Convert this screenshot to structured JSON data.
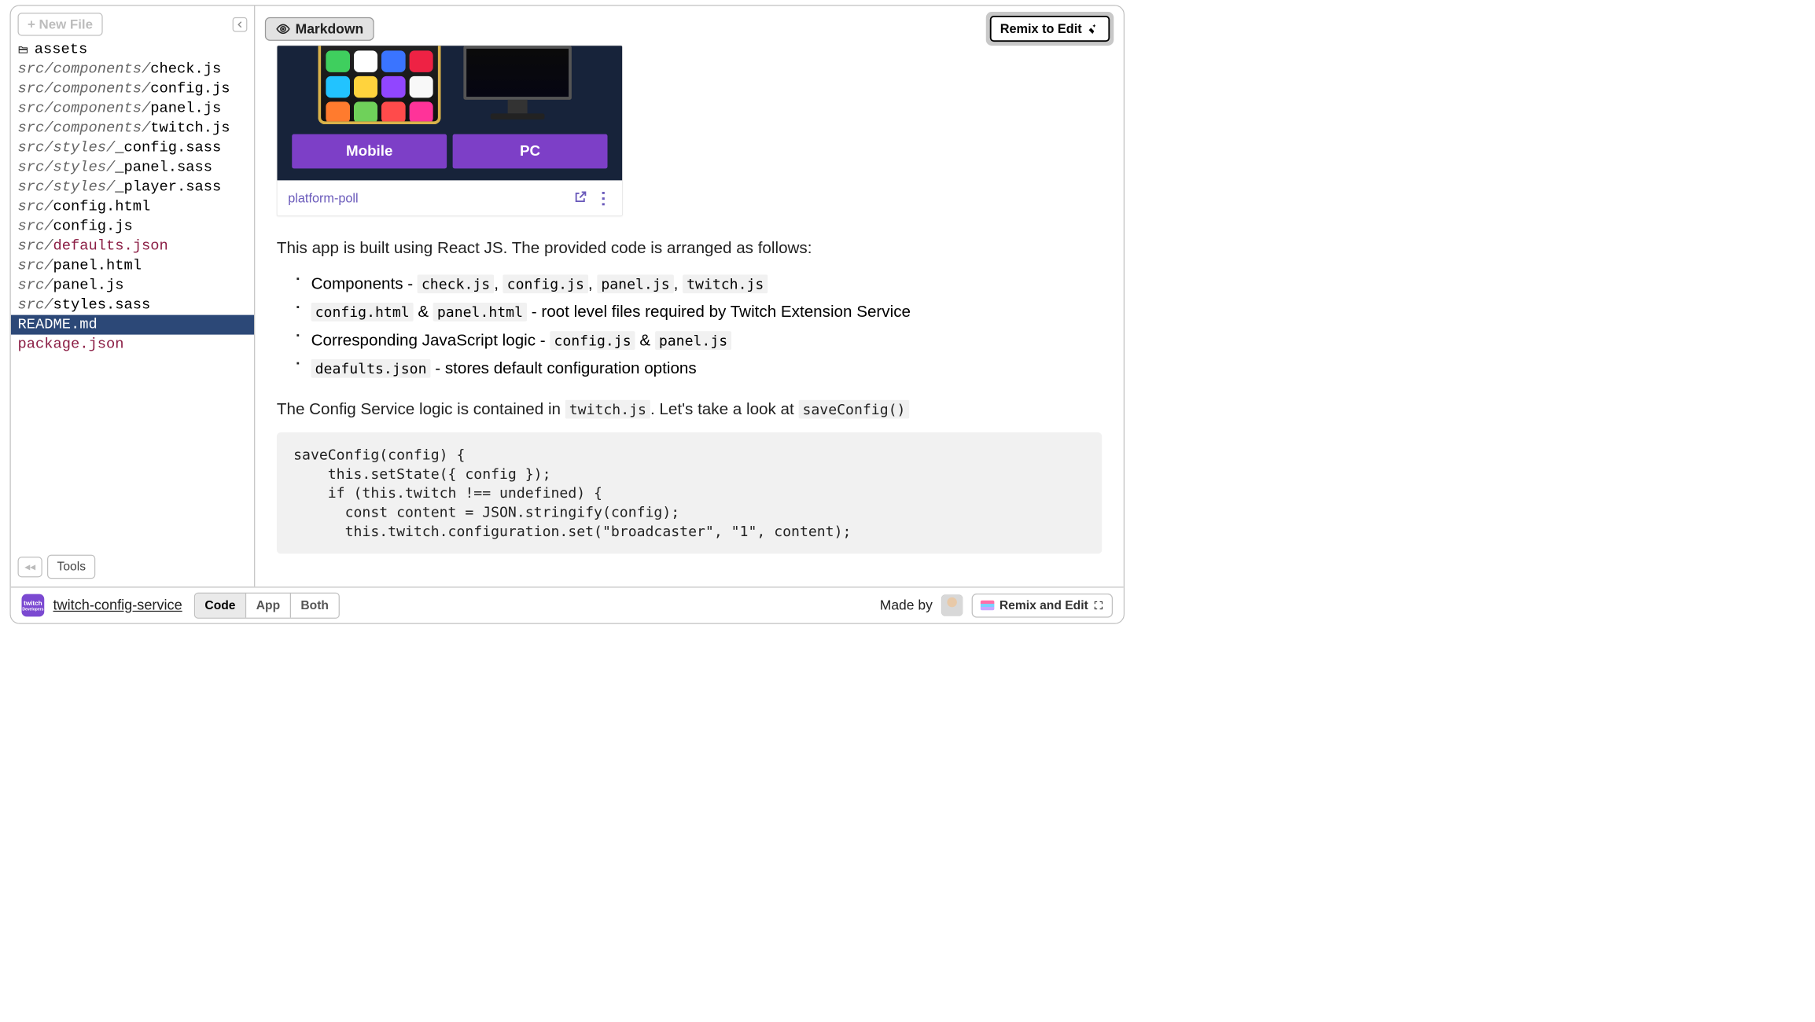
{
  "sidebar": {
    "new_file_label": "+ New File",
    "files": [
      {
        "type": "folder",
        "prefix": "",
        "name": "assets",
        "ext": ""
      },
      {
        "type": "file",
        "prefix": "src/components/",
        "name": "check",
        "ext": ".js"
      },
      {
        "type": "file",
        "prefix": "src/components/",
        "name": "config",
        "ext": ".js"
      },
      {
        "type": "file",
        "prefix": "src/components/",
        "name": "panel",
        "ext": ".js"
      },
      {
        "type": "file",
        "prefix": "src/components/",
        "name": "twitch",
        "ext": ".js"
      },
      {
        "type": "file",
        "prefix": "src/styles/",
        "name": "_config",
        "ext": ".sass"
      },
      {
        "type": "file",
        "prefix": "src/styles/",
        "name": "_panel",
        "ext": ".sass"
      },
      {
        "type": "file",
        "prefix": "src/styles/",
        "name": "_player",
        "ext": ".sass"
      },
      {
        "type": "file",
        "prefix": "src/",
        "name": "config",
        "ext": ".html"
      },
      {
        "type": "file",
        "prefix": "src/",
        "name": "config",
        "ext": ".js"
      },
      {
        "type": "file",
        "prefix": "src/",
        "name": "defaults",
        "ext": ".json"
      },
      {
        "type": "file",
        "prefix": "src/",
        "name": "panel",
        "ext": ".html"
      },
      {
        "type": "file",
        "prefix": "src/",
        "name": "panel",
        "ext": ".js"
      },
      {
        "type": "file",
        "prefix": "src/",
        "name": "styles",
        "ext": ".sass"
      },
      {
        "type": "file",
        "prefix": "",
        "name": "README",
        "ext": ".md",
        "selected": true
      },
      {
        "type": "file",
        "prefix": "",
        "name": "package",
        "ext": ".json"
      }
    ],
    "tools_label": "Tools"
  },
  "toolbar": {
    "markdown_label": "Markdown",
    "remix_edit_label": "Remix to Edit"
  },
  "doc": {
    "screenshot": {
      "vote_mobile": "Mobile",
      "vote_pc": "PC",
      "poll_name": "platform-poll"
    },
    "para1": "This app is built using React JS. The provided code is arranged as follows:",
    "li1_lead": "Components - ",
    "li1_codes": [
      "check.js",
      "config.js",
      "panel.js",
      "twitch.js"
    ],
    "li2_code1": "config.html",
    "li2_amp": " & ",
    "li2_code2": "panel.html",
    "li2_tail": " - root level files required by Twitch Extension Service",
    "li3_lead": "Corresponding JavaScript logic - ",
    "li3_code1": "config.js",
    "li3_amp": " & ",
    "li3_code2": "panel.js",
    "li4_code": "deafults.json",
    "li4_tail": " - stores default configuration options",
    "para2_lead": "The Config Service logic is contained in ",
    "para2_code": "twitch.js",
    "para2_mid": ". Let's take a look at ",
    "para2_code2": "saveConfig()",
    "code_block": "saveConfig(config) {\n    this.setState({ config });\n    if (this.twitch !== undefined) {\n      const content = JSON.stringify(config);\n      this.twitch.configuration.set(\"broadcaster\", \"1\", content);"
  },
  "bottom": {
    "project_name": "twitch-config-service",
    "tabs": [
      "Code",
      "App",
      "Both"
    ],
    "active_tab": 0,
    "made_by": "Made by",
    "remix_label": "Remix and Edit"
  }
}
